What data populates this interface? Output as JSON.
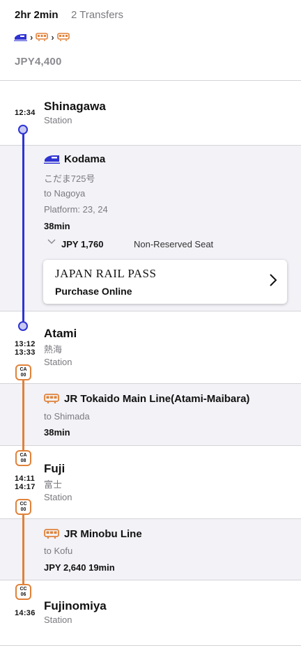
{
  "summary": {
    "duration": "2hr 2min",
    "transfers": "2 Transfers",
    "fare": "JPY4,400",
    "route_icons": [
      "shinkansen-icon",
      "train-icon",
      "train-icon"
    ]
  },
  "colors": {
    "shinkansen": "#2f33d2",
    "local": "#e0823a",
    "band": "#f2f2f7"
  },
  "stations": [
    {
      "name": "Shinagawa",
      "type": "Station",
      "time": "12:34"
    },
    {
      "name": "Atami",
      "kanji": "熱海",
      "type": "Station",
      "arrive": "13:12",
      "depart": "13:33",
      "code_in": [
        "CA",
        "00"
      ]
    },
    {
      "name": "Fuji",
      "kanji": "富士",
      "type": "Station",
      "arrive": "14:11",
      "depart": "14:17",
      "code_arr": [
        "CA",
        "08"
      ],
      "code_dep": [
        "CC",
        "00"
      ]
    },
    {
      "name": "Fujinomiya",
      "type": "Station",
      "time": "14:36",
      "code": [
        "CC",
        "06"
      ]
    }
  ],
  "legs": [
    {
      "line": "Kodama",
      "train": "こだま725号",
      "direction": "to Nagoya",
      "platform": "Platform: 23, 24",
      "duration": "38min",
      "price": "JPY 1,760",
      "seat": "Non-Reserved Seat",
      "pass": {
        "brand": "JAPAN RAIL PASS",
        "action": "Purchase Online"
      }
    },
    {
      "line": "JR Tokaido Main Line(Atami-Maibara)",
      "direction": "to Shimada",
      "duration": "38min"
    },
    {
      "line": "JR Minobu Line",
      "direction": "to Kofu",
      "price_duration": "JPY 2,640 19min"
    }
  ]
}
